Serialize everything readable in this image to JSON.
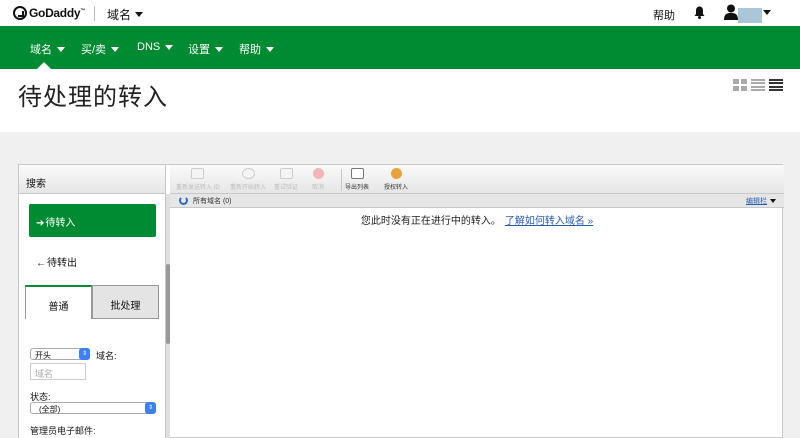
{
  "topbar": {
    "logo_text": "GoDaddy",
    "logo_tm": "™",
    "domains_label": "域名",
    "help_label": "帮助"
  },
  "nav": {
    "items": [
      {
        "label": "域名"
      },
      {
        "label": "买/卖"
      },
      {
        "label": "DNS"
      },
      {
        "label": "设置"
      },
      {
        "label": "帮助"
      }
    ]
  },
  "page": {
    "title": "待处理的转入"
  },
  "sidebar": {
    "header": "搜索",
    "incoming_label": "待转入",
    "outgoing_label": "待转出",
    "arrow_in": "➔",
    "arrow_out": "←",
    "tabs": [
      {
        "label": "普通"
      },
      {
        "label": "批处理"
      }
    ],
    "match_select": "开头",
    "domain_label": "域名:",
    "domain_placeholder": "域名",
    "status_label": "状态:",
    "status_select": "(全部)",
    "admin_email_label": "管理员电子邮件:"
  },
  "toolbar": {
    "buttons": [
      {
        "label": "重新发送转入 ID",
        "enabled": false
      },
      {
        "label": "重新开始转入",
        "enabled": false
      },
      {
        "label": "重试验证",
        "enabled": false
      },
      {
        "label": "取消",
        "enabled": false
      },
      {
        "label": "导出列表",
        "enabled": true
      },
      {
        "label": "授权转入",
        "enabled": true
      }
    ]
  },
  "list": {
    "breadcrumb": "所有域名 (0)",
    "edit_columns": "编辑栏",
    "empty_message": "您此时没有正在进行中的转入。",
    "empty_link": "了解如何转入域名 »"
  },
  "colors": {
    "brand_green": "#008a32",
    "link_blue": "#2a5db0"
  }
}
